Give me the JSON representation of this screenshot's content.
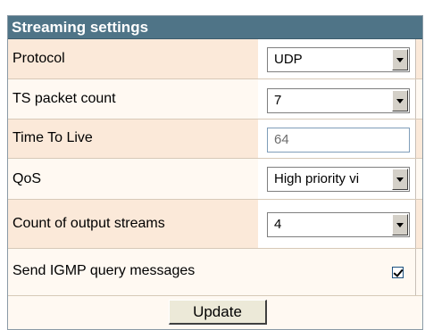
{
  "panel": {
    "title": "Streaming settings"
  },
  "rows": [
    {
      "label": "Protocol",
      "control": "select",
      "value": "UDP"
    },
    {
      "label": "TS packet count",
      "control": "select",
      "value": "7"
    },
    {
      "label": "Time To Live",
      "control": "text",
      "value": "64"
    },
    {
      "label": "QoS",
      "control": "select",
      "value": "High priority vi"
    },
    {
      "label": "Count of output streams",
      "control": "select",
      "value": "4"
    },
    {
      "label": "Send IGMP query messages",
      "control": "checkbox",
      "checked": true
    }
  ],
  "actions": {
    "update_label": "Update"
  },
  "colors": {
    "header_bg": "#4f7487",
    "row_odd": "#fbe9d9",
    "row_even": "#fff9f2"
  }
}
